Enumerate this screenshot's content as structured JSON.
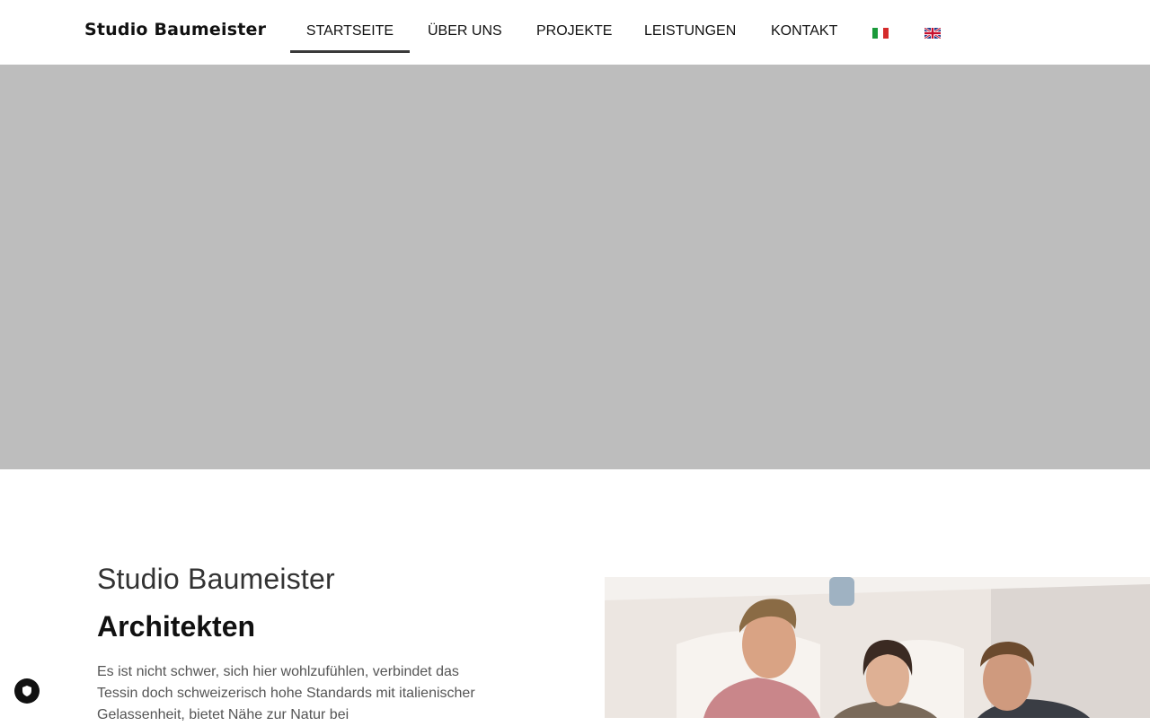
{
  "header": {
    "logo": "Studio Baumeister",
    "nav": [
      {
        "label": "STARTSEITE",
        "active": true
      },
      {
        "label": "ÜBER UNS",
        "active": false
      },
      {
        "label": "PROJEKTE",
        "active": false
      },
      {
        "label": "LEISTUNGEN",
        "active": false
      },
      {
        "label": "KONTAKT",
        "active": false
      }
    ],
    "languages": [
      {
        "icon": "italian-flag-icon"
      },
      {
        "icon": "english-flag-icon"
      }
    ]
  },
  "hero": {
    "background": "#bdbdbd"
  },
  "intro": {
    "title": "Studio Baumeister",
    "subtitle": "Architekten",
    "text": "Es ist nicht schwer, sich hier wohlzufühlen, verbindet das Tessin doch schweizerisch hohe Standards mit italienischer Gelassenheit, bietet Nähe zur Natur bei"
  },
  "privacy": {
    "icon": "shield-icon"
  }
}
